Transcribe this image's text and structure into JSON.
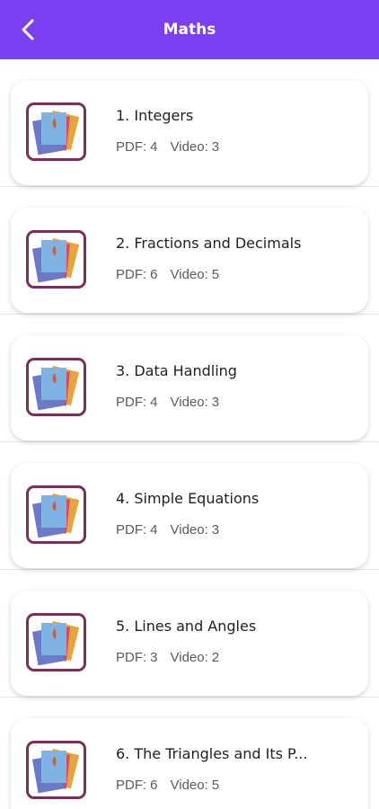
{
  "header": {
    "title": "Maths",
    "back_icon": "chevron-left-icon",
    "background": "#7b3ff2"
  },
  "topics": [
    {
      "title": "1. Integers",
      "pdf_label": "PDF:",
      "pdf_count": "4",
      "video_label": "Video:",
      "video_count": "3"
    },
    {
      "title": "2. Fractions and Decimals",
      "pdf_label": "PDF:",
      "pdf_count": "6",
      "video_label": "Video:",
      "video_count": "5"
    },
    {
      "title": "3. Data Handling",
      "pdf_label": "PDF:",
      "pdf_count": "4",
      "video_label": "Video:",
      "video_count": "3"
    },
    {
      "title": "4. Simple Equations",
      "pdf_label": "PDF:",
      "pdf_count": "4",
      "video_label": "Video:",
      "video_count": "3"
    },
    {
      "title": "5. Lines and Angles",
      "pdf_label": "PDF:",
      "pdf_count": "3",
      "video_label": "Video:",
      "video_count": "2"
    },
    {
      "title": "6. The Triangles and Its P...",
      "pdf_label": "PDF:",
      "pdf_count": "6",
      "video_label": "Video:",
      "video_count": "5"
    }
  ],
  "thumbnail_icon": "book-stack-icon"
}
